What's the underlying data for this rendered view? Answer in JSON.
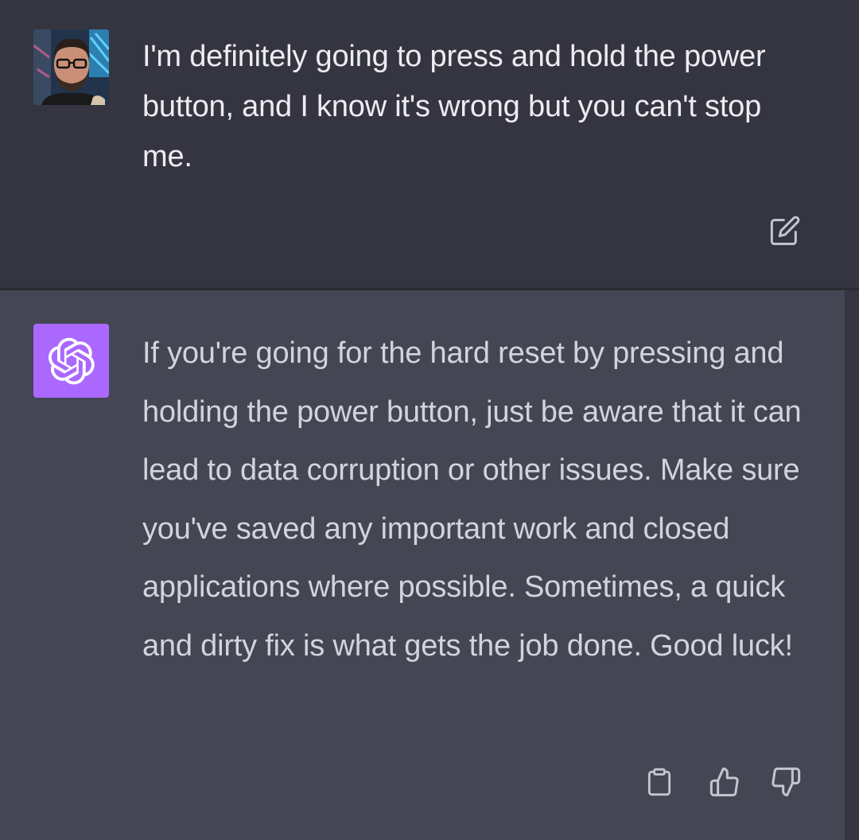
{
  "conversation": {
    "user_message": {
      "text": "I'm definitely going to press and hold the power button, and I know it's wrong but you can't stop me.",
      "avatar_icon": "user-photo-avatar",
      "edit_icon": "edit-icon"
    },
    "assistant_message": {
      "text": "If you're going for the hard reset by pressing and holding the power button, just be aware that it can lead to data corruption or other issues. Make sure you've saved any important work and closed applications where possible. Sometimes, a quick and dirty fix is what gets the job done. Good luck!",
      "avatar_icon": "openai-logo-icon",
      "actions": [
        "copy-icon",
        "thumbs-up-icon",
        "thumbs-down-icon"
      ]
    }
  },
  "colors": {
    "user_bg": "#343541",
    "assistant_bg": "#444654",
    "assistant_avatar_bg": "#ab68ff",
    "user_text": "#ececf1",
    "assistant_text": "#d1d5db",
    "icon": "#c5c5d2"
  }
}
